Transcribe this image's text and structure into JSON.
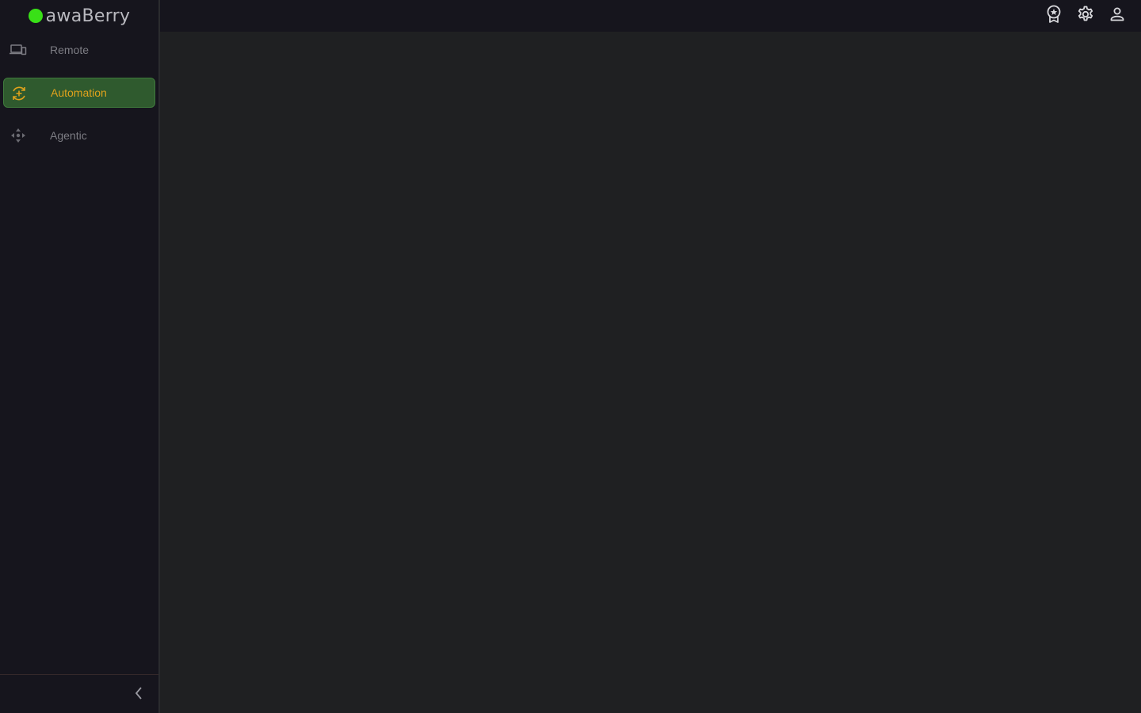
{
  "brand": {
    "name": "awaBerry",
    "dot_color": "#39e017"
  },
  "sidebar": {
    "items": [
      {
        "label": "Remote",
        "icon": "devices-icon",
        "active": false
      },
      {
        "label": "Automation",
        "icon": "automation-cycle-icon",
        "active": true
      },
      {
        "label": "Agentic",
        "icon": "move-arrows-icon",
        "active": false
      }
    ],
    "collapse_icon": "chevron-left-icon"
  },
  "topbar": {
    "actions": [
      {
        "icon": "award-badge-icon"
      },
      {
        "icon": "gear-icon"
      },
      {
        "icon": "user-icon"
      }
    ]
  },
  "colors": {
    "accent_active_text": "#e0a21c",
    "active_bg": "#2f5a2e",
    "sidebar_bg": "#16151d",
    "main_bg": "#1f2022"
  }
}
